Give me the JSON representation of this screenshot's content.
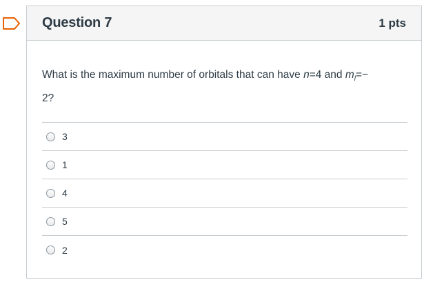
{
  "bookmark": {
    "icon": "bookmark-flag-icon",
    "color": "#e66000"
  },
  "question": {
    "title": "Question 7",
    "points": "1 pts",
    "text_parts": {
      "prefix": "What is the maximum number of orbitals that can have ",
      "n_symbol": "n",
      "n_value": "=4 and ",
      "m_symbol": "m",
      "m_subscript": "l",
      "m_value": "=−",
      "line2": "2?"
    },
    "answers": [
      {
        "label": "3"
      },
      {
        "label": "1"
      },
      {
        "label": "4"
      },
      {
        "label": "5"
      },
      {
        "label": "2"
      }
    ]
  }
}
